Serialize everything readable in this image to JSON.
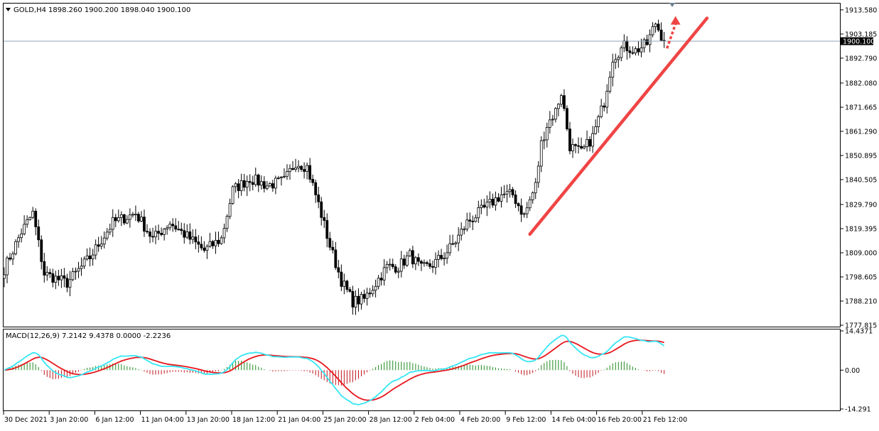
{
  "header": {
    "symbol_label": "GOLD,H4",
    "ohlc": "1898.260 1900.200 1898.040 1900.100",
    "menu_arrow_icon": "triangle-down-icon"
  },
  "price_axis": {
    "ticks": [
      "1913.580",
      "1903.185",
      "1892.790",
      "1882.080",
      "1871.665",
      "1861.290",
      "1850.895",
      "1840.505",
      "1829.790",
      "1819.395",
      "1809.000",
      "1798.605",
      "1788.210",
      "1777.815"
    ],
    "current_price": "1900.100"
  },
  "macd": {
    "label": "MACD(12,26,9) 7.2142 9.4378 0.0000 -2.2236",
    "ticks": [
      "14.4371",
      "0.00",
      "-14.291"
    ]
  },
  "time_axis": {
    "labels": [
      "30 Dec 2021",
      "3 Jan 20:00",
      "6 Jan 12:00",
      "11 Jan 04:00",
      "13 Jan 20:00",
      "18 Jan 12:00",
      "21 Jan 04:00",
      "25 Jan 20:00",
      "28 Jan 12:00",
      "2 Feb 04:00",
      "4 Feb 20:00",
      "9 Feb 12:00",
      "14 Feb 04:00",
      "16 Feb 20:00",
      "21 Feb 12:00"
    ]
  },
  "colors": {
    "bull": "#ffffff",
    "bear": "#000000",
    "macd_line": "#e8151c",
    "signal_line": "#35e6f5",
    "hist_pos": "#1e8a1e",
    "hist_neg": "#c0141c",
    "trendline": "#f04444",
    "current_price_line": "#8fa3b5"
  },
  "chart_data": [
    {
      "type": "candlestick",
      "title": "GOLD,H4",
      "ylim": [
        1777.815,
        1916.0
      ],
      "trend_anchors": [
        {
          "t": 0,
          "p": 1802
        },
        {
          "t": 6,
          "p": 1818
        },
        {
          "t": 10,
          "p": 1826
        },
        {
          "t": 14,
          "p": 1800
        },
        {
          "t": 22,
          "p": 1796
        },
        {
          "t": 30,
          "p": 1807
        },
        {
          "t": 38,
          "p": 1822
        },
        {
          "t": 46,
          "p": 1826
        },
        {
          "t": 52,
          "p": 1815
        },
        {
          "t": 58,
          "p": 1822
        },
        {
          "t": 64,
          "p": 1816
        },
        {
          "t": 70,
          "p": 1810
        },
        {
          "t": 76,
          "p": 1815
        },
        {
          "t": 80,
          "p": 1836
        },
        {
          "t": 86,
          "p": 1841
        },
        {
          "t": 92,
          "p": 1838
        },
        {
          "t": 98,
          "p": 1840
        },
        {
          "t": 102,
          "p": 1848
        },
        {
          "t": 106,
          "p": 1846
        },
        {
          "t": 110,
          "p": 1830
        },
        {
          "t": 114,
          "p": 1812
        },
        {
          "t": 118,
          "p": 1797
        },
        {
          "t": 122,
          "p": 1788
        },
        {
          "t": 126,
          "p": 1789
        },
        {
          "t": 130,
          "p": 1796
        },
        {
          "t": 134,
          "p": 1803
        },
        {
          "t": 138,
          "p": 1803
        },
        {
          "t": 142,
          "p": 1808
        },
        {
          "t": 146,
          "p": 1802
        },
        {
          "t": 150,
          "p": 1804
        },
        {
          "t": 154,
          "p": 1808
        },
        {
          "t": 158,
          "p": 1814
        },
        {
          "t": 162,
          "p": 1822
        },
        {
          "t": 166,
          "p": 1826
        },
        {
          "t": 170,
          "p": 1830
        },
        {
          "t": 174,
          "p": 1834
        },
        {
          "t": 178,
          "p": 1834
        },
        {
          "t": 182,
          "p": 1825
        },
        {
          "t": 186,
          "p": 1838
        },
        {
          "t": 188,
          "p": 1856
        },
        {
          "t": 190,
          "p": 1864
        },
        {
          "t": 193,
          "p": 1870
        },
        {
          "t": 195,
          "p": 1878
        },
        {
          "t": 198,
          "p": 1855
        },
        {
          "t": 202,
          "p": 1852
        },
        {
          "t": 206,
          "p": 1859
        },
        {
          "t": 210,
          "p": 1874
        },
        {
          "t": 213,
          "p": 1893
        },
        {
          "t": 217,
          "p": 1898
        },
        {
          "t": 221,
          "p": 1896
        },
        {
          "t": 225,
          "p": 1899
        },
        {
          "t": 228,
          "p": 1908
        },
        {
          "t": 231,
          "p": 1900
        }
      ],
      "current_price": 1900.1
    },
    {
      "type": "line",
      "title": "MACD(12,26,9) 7.2142 9.4378 0.0000 -2.2236",
      "ylim": [
        -14.291,
        14.4371
      ],
      "series": [
        {
          "name": "MACD",
          "role": "fast"
        },
        {
          "name": "Signal",
          "role": "slow"
        },
        {
          "name": "Histogram",
          "role": "diff"
        }
      ]
    },
    {
      "type": "annotation",
      "trendline": {
        "from": {
          "t": 184,
          "p": 1817
        },
        "to": {
          "t": 246,
          "p": 1910
        }
      },
      "arrow": {
        "from": {
          "t": 232,
          "p": 1897
        },
        "to": {
          "t": 233,
          "p": 1910
        }
      }
    }
  ]
}
